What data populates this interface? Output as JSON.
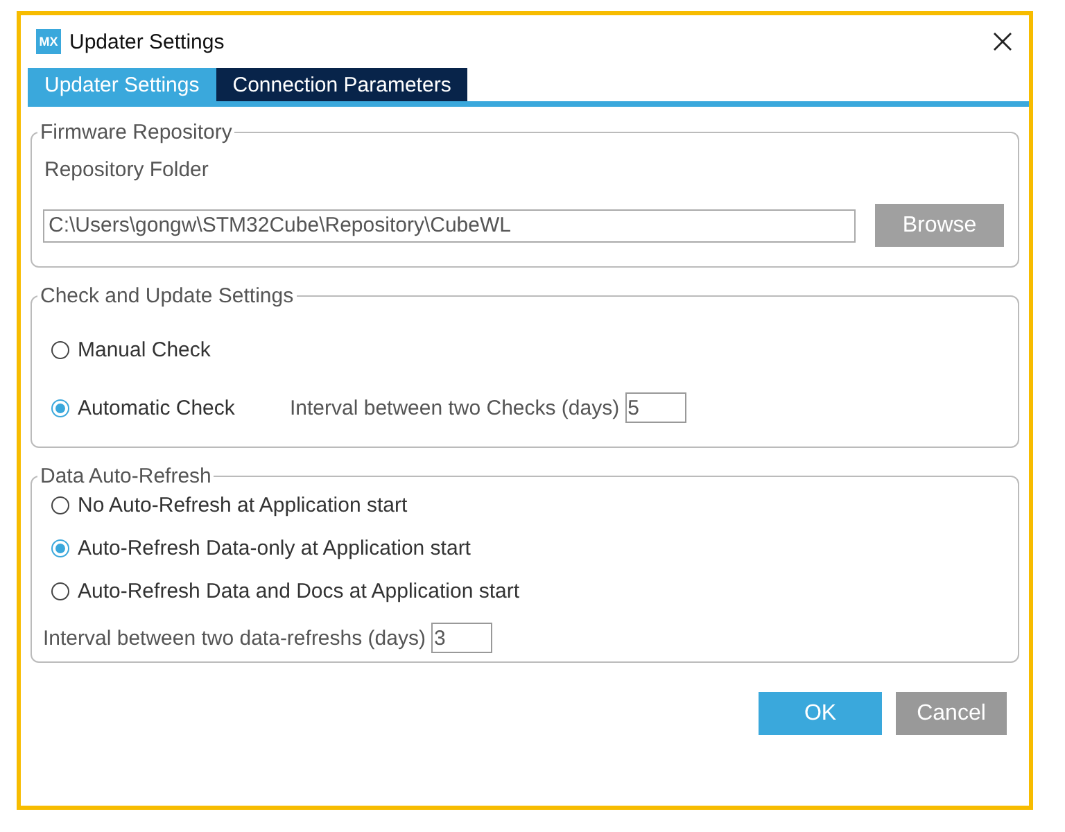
{
  "window": {
    "app_icon": "MX",
    "title": "Updater Settings"
  },
  "tabs": [
    {
      "label": "Updater Settings",
      "selected": true
    },
    {
      "label": "Connection Parameters",
      "selected": false
    }
  ],
  "firmware_repository": {
    "title": "Firmware Repository",
    "folder_label": "Repository Folder",
    "folder": "C:\\Users\\gongw\\STM32Cube\\Repository\\CubeWL",
    "browse": "Browse"
  },
  "check_and_update": {
    "title": "Check and Update Settings",
    "options": [
      {
        "label": "Manual Check",
        "selected": false
      },
      {
        "label": "Automatic Check",
        "selected": true
      }
    ],
    "interval_label": "Interval between two Checks (days)",
    "interval": "5"
  },
  "data_auto_refresh": {
    "title": "Data Auto-Refresh",
    "options": [
      {
        "label": "No Auto-Refresh at Application start",
        "selected": false
      },
      {
        "label": "Auto-Refresh Data-only at Application start",
        "selected": true
      },
      {
        "label": "Auto-Refresh Data and Docs at Application start",
        "selected": false
      }
    ],
    "interval_label": "Interval between two data-refreshs (days)",
    "interval": "3"
  },
  "buttons": [
    {
      "label": "OK",
      "kind": "primary"
    },
    {
      "label": "Cancel",
      "kind": "secondary"
    }
  ]
}
